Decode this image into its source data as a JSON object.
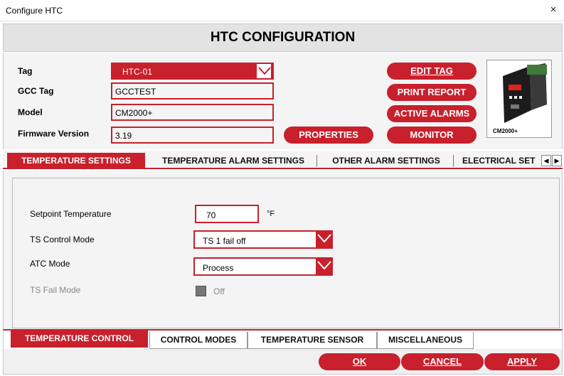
{
  "window": {
    "title": "Configure HTC",
    "close": "×"
  },
  "banner": {
    "title": "HTC CONFIGURATION"
  },
  "tag_panel": {
    "fields": [
      {
        "label": "Tag",
        "value": "HTC-01"
      },
      {
        "label": "GCC Tag",
        "value": "GCCTEST"
      },
      {
        "label": "Model",
        "value": "CM2000+"
      },
      {
        "label": "Firmware Version",
        "value": "3.19"
      }
    ],
    "buttons": {
      "edit_tag": "EDIT TAG",
      "print_report": "PRINT REPORT",
      "active_alarms": "ACTIVE ALARMS",
      "monitor": "MONITOR",
      "properties": "PROPERTIES"
    },
    "device_image_label": "CM2000+"
  },
  "top_tabs": [
    {
      "label": "TEMPERATURE SETTINGS",
      "active": true
    },
    {
      "label": "TEMPERATURE ALARM SETTINGS",
      "active": false
    },
    {
      "label": "OTHER ALARM SETTINGS",
      "active": false
    },
    {
      "label": "ELECTRICAL SET",
      "active": false
    }
  ],
  "settings": {
    "setpoint": {
      "label": "Setpoint Temperature",
      "value": "70",
      "unit": "°F"
    },
    "ts_control_mode": {
      "label": "TS Control Mode",
      "value": "TS 1 fail off"
    },
    "atc_mode": {
      "label": "ATC Mode",
      "value": "Process"
    },
    "ts_fail_mode": {
      "label": "TS Fail Mode",
      "value": "Off"
    }
  },
  "bottom_tabs": [
    {
      "label": "TEMPERATURE CONTROL",
      "active": true
    },
    {
      "label": "CONTROL MODES",
      "active": false
    },
    {
      "label": "TEMPERATURE SENSOR",
      "active": false
    },
    {
      "label": "MISCELLANEOUS",
      "active": false
    }
  ],
  "footer": {
    "ok": "OK",
    "cancel": "CANCEL",
    "apply": "APPLY"
  },
  "colors": {
    "accent": "#c8202c",
    "panel": "#f4f4f4"
  }
}
